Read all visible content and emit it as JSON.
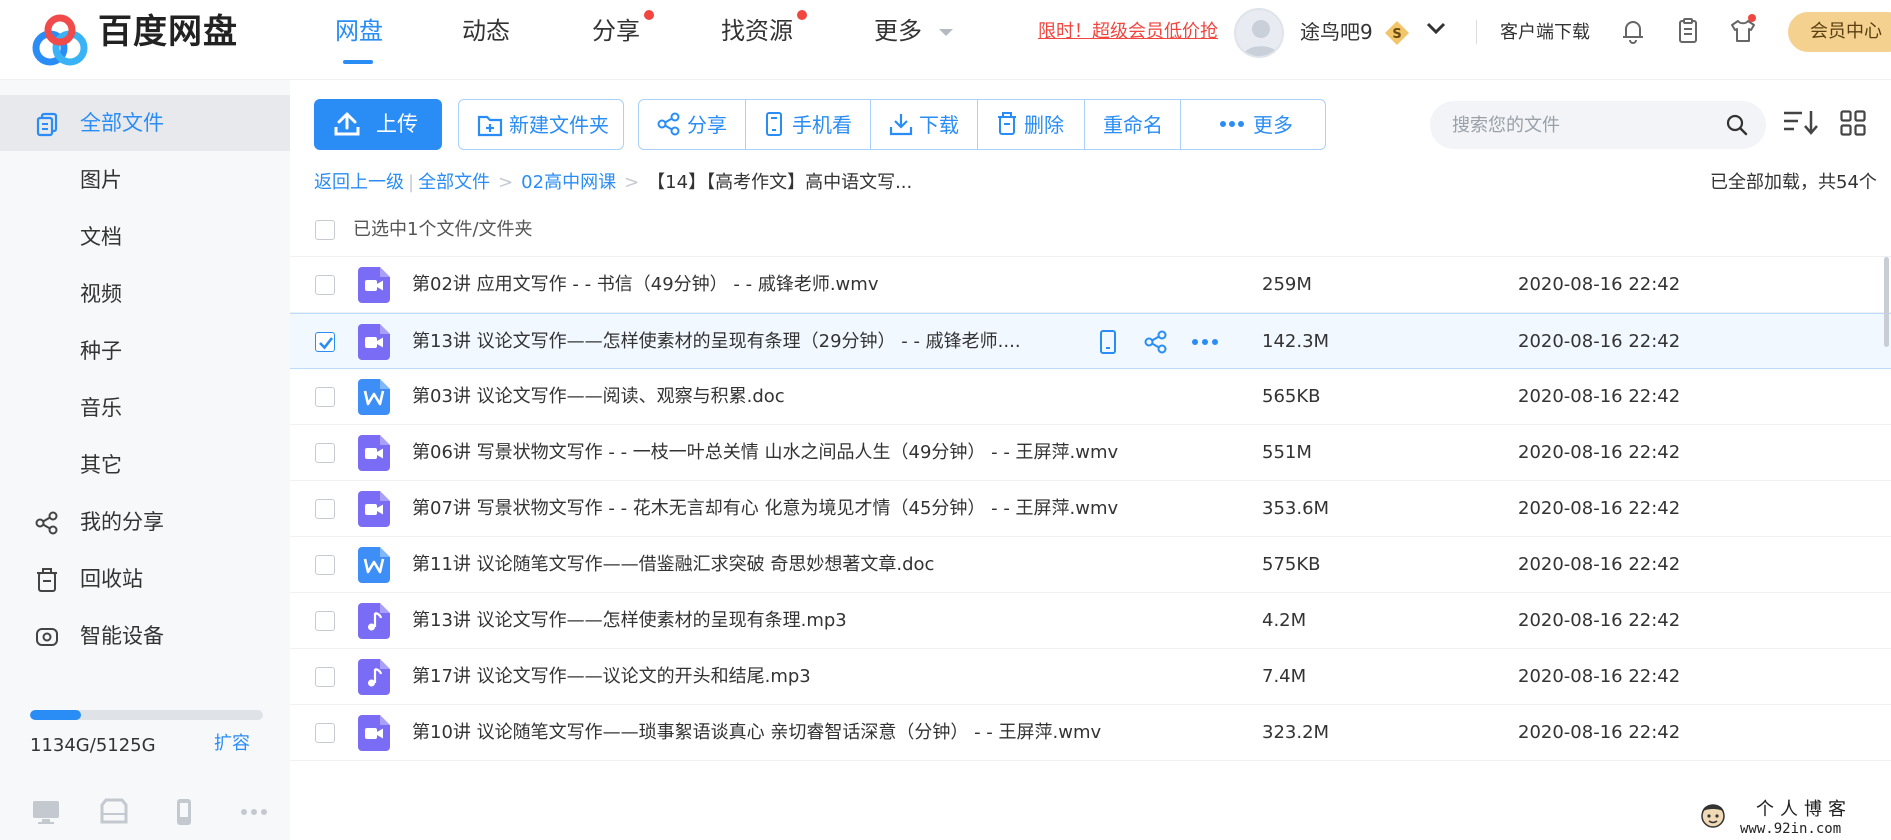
{
  "header": {
    "logo_text": "百度网盘",
    "nav": [
      {
        "label": "网盘",
        "active": true
      },
      {
        "label": "动态"
      },
      {
        "label": "分享",
        "dot": true
      },
      {
        "label": "找资源",
        "dot": true
      },
      {
        "label": "更多"
      }
    ],
    "promo": "限时！超级会员低价抢",
    "username": "途鸟吧9",
    "vip_badge": "S",
    "client_download": "客户端下载",
    "member_center": "会员中心"
  },
  "sidebar": {
    "items": [
      {
        "label": "全部文件",
        "active": true,
        "icon": "all-files-icon"
      },
      {
        "label": "图片"
      },
      {
        "label": "文档"
      },
      {
        "label": "视频"
      },
      {
        "label": "种子"
      },
      {
        "label": "音乐"
      },
      {
        "label": "其它"
      },
      {
        "label": "我的分享",
        "icon": "share-icon"
      },
      {
        "label": "回收站",
        "icon": "recycle-bin-icon"
      },
      {
        "label": "智能设备",
        "icon": "smart-device-icon"
      }
    ],
    "quota_text": "1134G/5125G",
    "quota_used_fraction": 0.221,
    "expand_label": "扩容"
  },
  "toolbar": {
    "upload": "上传",
    "new_folder": "新建文件夹",
    "share": "分享",
    "phone_view": "手机看",
    "download": "下载",
    "delete": "删除",
    "rename": "重命名",
    "more": "更多",
    "search_placeholder": "搜索您的文件"
  },
  "breadcrumb": {
    "back": "返回上一级",
    "all_files": "全部文件",
    "folder": "02高中网课",
    "current": "【14】【高考作文】高中语文写...",
    "status": "已全部加载，共54个"
  },
  "selection": {
    "text": "已选中1个文件/文件夹"
  },
  "files": [
    {
      "name": "第02讲 应用文写作 - - 书信（49分钟） - - 戚锋老师.wmv",
      "size": "259M",
      "date": "2020-08-16 22:42",
      "type": "video",
      "checked": false
    },
    {
      "name": "第13讲 议论文写作——怎样使素材的呈现有条理（29分钟） - - 戚锋老师....",
      "size": "142.3M",
      "date": "2020-08-16 22:42",
      "type": "video",
      "checked": true
    },
    {
      "name": "第03讲 议论文写作——阅读、观察与积累.doc",
      "size": "565KB",
      "date": "2020-08-16 22:42",
      "type": "doc",
      "checked": false
    },
    {
      "name": "第06讲 写景状物文写作 - - 一枝一叶总关情 山水之间品人生（49分钟） - - 王屏萍.wmv",
      "size": "551M",
      "date": "2020-08-16 22:42",
      "type": "video",
      "checked": false
    },
    {
      "name": "第07讲 写景状物文写作 - - 花木无言却有心 化意为境见才情（45分钟） - - 王屏萍.wmv",
      "size": "353.6M",
      "date": "2020-08-16 22:42",
      "type": "video",
      "checked": false
    },
    {
      "name": "第11讲 议论随笔文写作——借鉴融汇求突破 奇思妙想著文章.doc",
      "size": "575KB",
      "date": "2020-08-16 22:42",
      "type": "doc",
      "checked": false
    },
    {
      "name": "第13讲 议论文写作——怎样使素材的呈现有条理.mp3",
      "size": "4.2M",
      "date": "2020-08-16 22:42",
      "type": "audio",
      "checked": false
    },
    {
      "name": "第17讲 议论文写作——议论文的开头和结尾.mp3",
      "size": "7.4M",
      "date": "2020-08-16 22:42",
      "type": "audio",
      "checked": false
    },
    {
      "name": "第10讲 议论随笔文写作——琐事絮语谈真心 亲切睿智话深意（分钟） - - 王屏萍.wmv",
      "size": "323.2M",
      "date": "2020-08-16 22:42",
      "type": "video",
      "checked": false
    }
  ],
  "watermark": {
    "title": "个人博客",
    "url": "www.92in.com"
  },
  "colors": {
    "accent": "#2a8df5",
    "promo": "#f0463f",
    "video_icon": "#7b6cf6",
    "doc_icon": "#3d8ff7",
    "member_gold": "#f4d18f"
  }
}
